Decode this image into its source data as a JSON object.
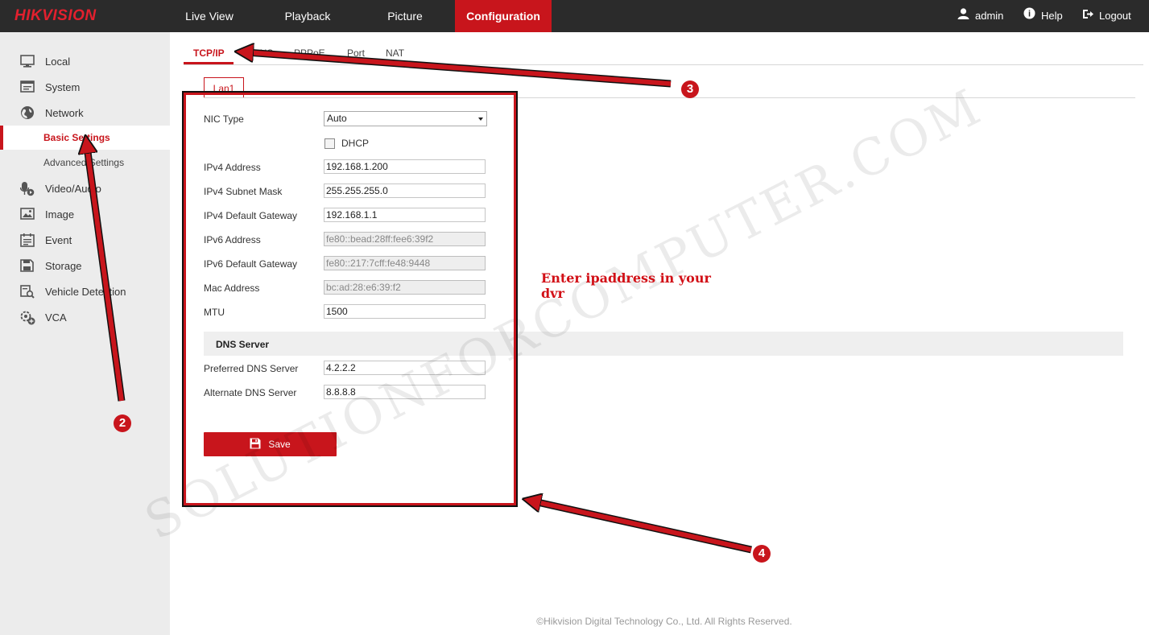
{
  "header": {
    "logo": "HIKVISION",
    "nav": [
      "Live View",
      "Playback",
      "Picture",
      "Configuration"
    ],
    "active_nav": "Configuration",
    "user": "admin",
    "help": "Help",
    "logout": "Logout"
  },
  "sidebar": {
    "items": [
      {
        "label": "Local",
        "icon": "monitor-icon"
      },
      {
        "label": "System",
        "icon": "system-icon"
      },
      {
        "label": "Network",
        "icon": "globe-icon"
      },
      {
        "label": "Basic Settings",
        "sub": true,
        "active": true
      },
      {
        "label": "Advanced Settings",
        "sub": true
      },
      {
        "label": "Video/Audio",
        "icon": "microphone-icon"
      },
      {
        "label": "Image",
        "icon": "image-icon"
      },
      {
        "label": "Event",
        "icon": "event-icon"
      },
      {
        "label": "Storage",
        "icon": "storage-icon"
      },
      {
        "label": "Vehicle Detection",
        "icon": "vehicle-search-icon"
      },
      {
        "label": "VCA",
        "icon": "vca-icon"
      }
    ]
  },
  "tabs": [
    "TCP/IP",
    "DNS",
    "PPPoE",
    "Port",
    "NAT"
  ],
  "active_tab": "TCP/IP",
  "subtab": "Lan1",
  "form": {
    "nic_type_label": "NIC Type",
    "nic_type_value": "Auto",
    "dhcp_label": "DHCP",
    "dhcp_checked": false,
    "ipv4_address_label": "IPv4 Address",
    "ipv4_address": "192.168.1.200",
    "ipv4_mask_label": "IPv4 Subnet Mask",
    "ipv4_mask": "255.255.255.0",
    "ipv4_gateway_label": "IPv4 Default Gateway",
    "ipv4_gateway": "192.168.1.1",
    "ipv6_address_label": "IPv6 Address",
    "ipv6_address": "fe80::bead:28ff:fee6:39f2",
    "ipv6_gateway_label": "IPv6 Default Gateway",
    "ipv6_gateway": "fe80::217:7cff:fe48:9448",
    "mac_label": "Mac Address",
    "mac": "bc:ad:28:e6:39:f2",
    "mtu_label": "MTU",
    "mtu": "1500",
    "dns_section": "DNS Server",
    "preferred_dns_label": "Preferred DNS Server",
    "preferred_dns": "4.2.2.2",
    "alternate_dns_label": "Alternate DNS Server",
    "alternate_dns": "8.8.8.8",
    "save_label": "Save"
  },
  "annotations": {
    "note_line1": "Enter ipaddress in your",
    "note_line2": "dvr",
    "badge_2": "2",
    "badge_3": "3",
    "badge_4": "4",
    "watermark": "SOLUTIONFORCOMPUTER.COM",
    "accent_color": "#c8151c"
  },
  "footer": "©Hikvision Digital Technology Co., Ltd. All Rights Reserved."
}
